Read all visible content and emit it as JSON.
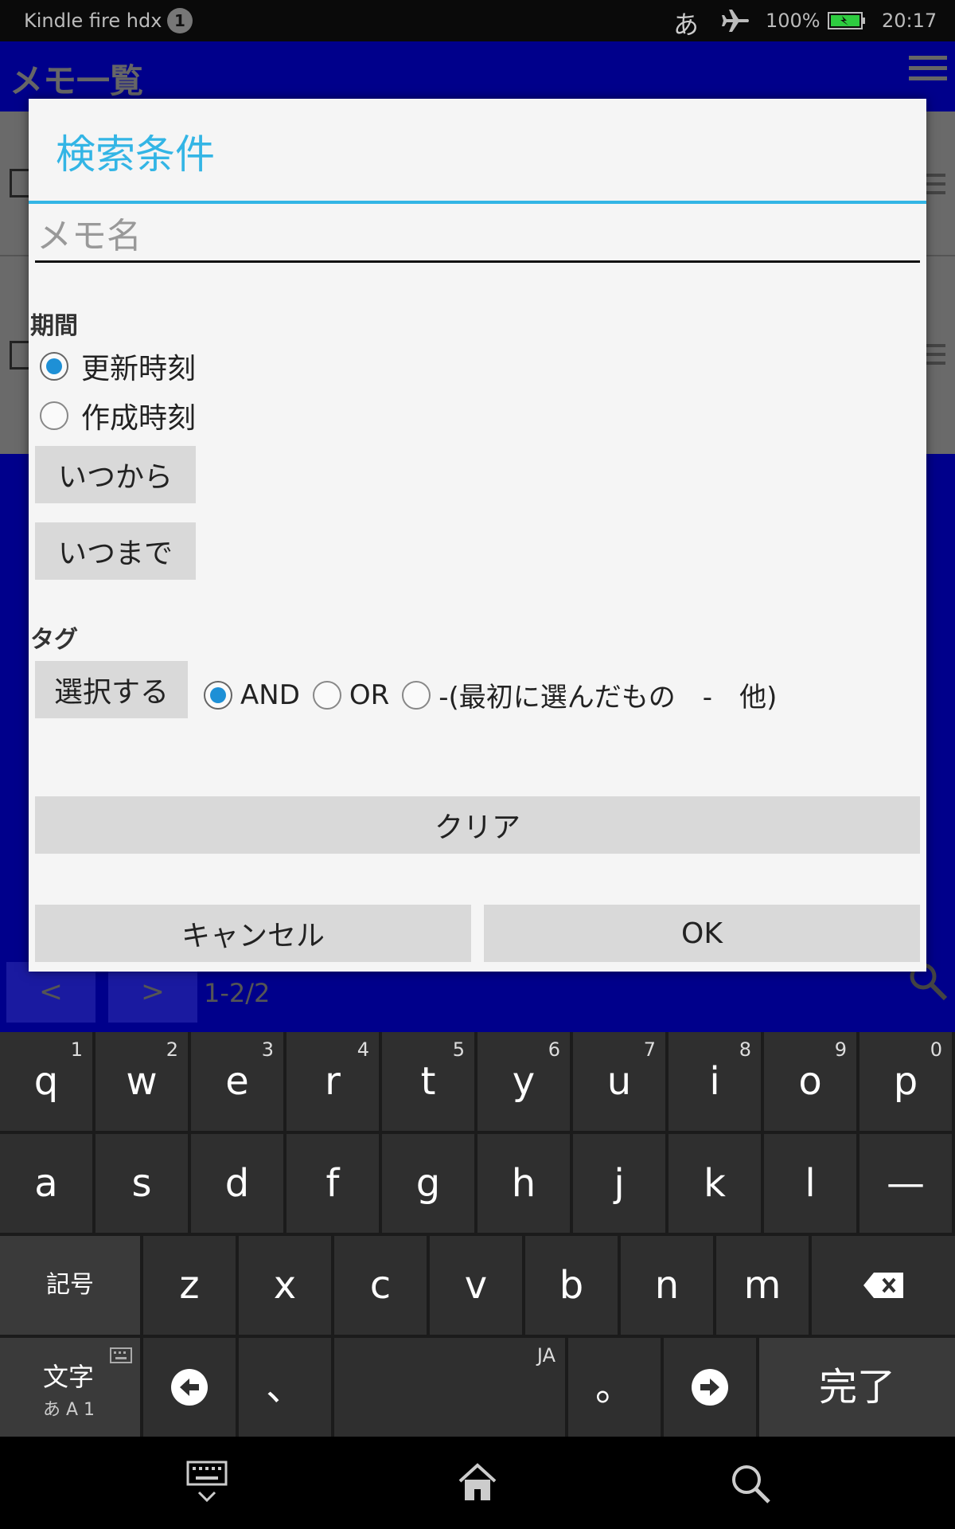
{
  "status_bar": {
    "device": "Kindle fire hdx",
    "notification_count": "1",
    "ime_indicator": "あ",
    "battery": "100%",
    "time": "20:17"
  },
  "app_bar": {
    "title": "メモ一覧"
  },
  "pager": {
    "prev": "<",
    "next": ">",
    "count": "1-2/2"
  },
  "dialog": {
    "title": "検索条件",
    "memo_placeholder": "メモ名",
    "period_label": "期間",
    "period_options": [
      "更新時刻",
      "作成時刻"
    ],
    "period_selected": 0,
    "from_button": "いつから",
    "to_button": "いつまで",
    "tag_label": "タグ",
    "select_button": "選択する",
    "tag_ops": [
      "AND",
      "OR",
      "-(最初に選んだもの　-　他)"
    ],
    "tag_op_selected": 0,
    "clear_button": "クリア",
    "cancel_button": "キャンセル",
    "ok_button": "OK"
  },
  "keyboard": {
    "row1": [
      [
        "q",
        "1"
      ],
      [
        "w",
        "2"
      ],
      [
        "e",
        "3"
      ],
      [
        "r",
        "4"
      ],
      [
        "t",
        "5"
      ],
      [
        "y",
        "6"
      ],
      [
        "u",
        "7"
      ],
      [
        "i",
        "8"
      ],
      [
        "o",
        "9"
      ],
      [
        "p",
        "0"
      ]
    ],
    "row2": [
      "a",
      "s",
      "d",
      "f",
      "g",
      "h",
      "j",
      "k",
      "l",
      "—"
    ],
    "row3": [
      "z",
      "x",
      "c",
      "v",
      "b",
      "n",
      "m"
    ],
    "symbols": "記号",
    "mode_main": "文字",
    "mode_sub": "あ A 1",
    "comma": "、",
    "space_hint": "JA",
    "period": "。",
    "done": "完了"
  },
  "colors": {
    "accent": "#33b5e5",
    "app_blue": "#00008b",
    "radio_on": "#1e90d6"
  }
}
